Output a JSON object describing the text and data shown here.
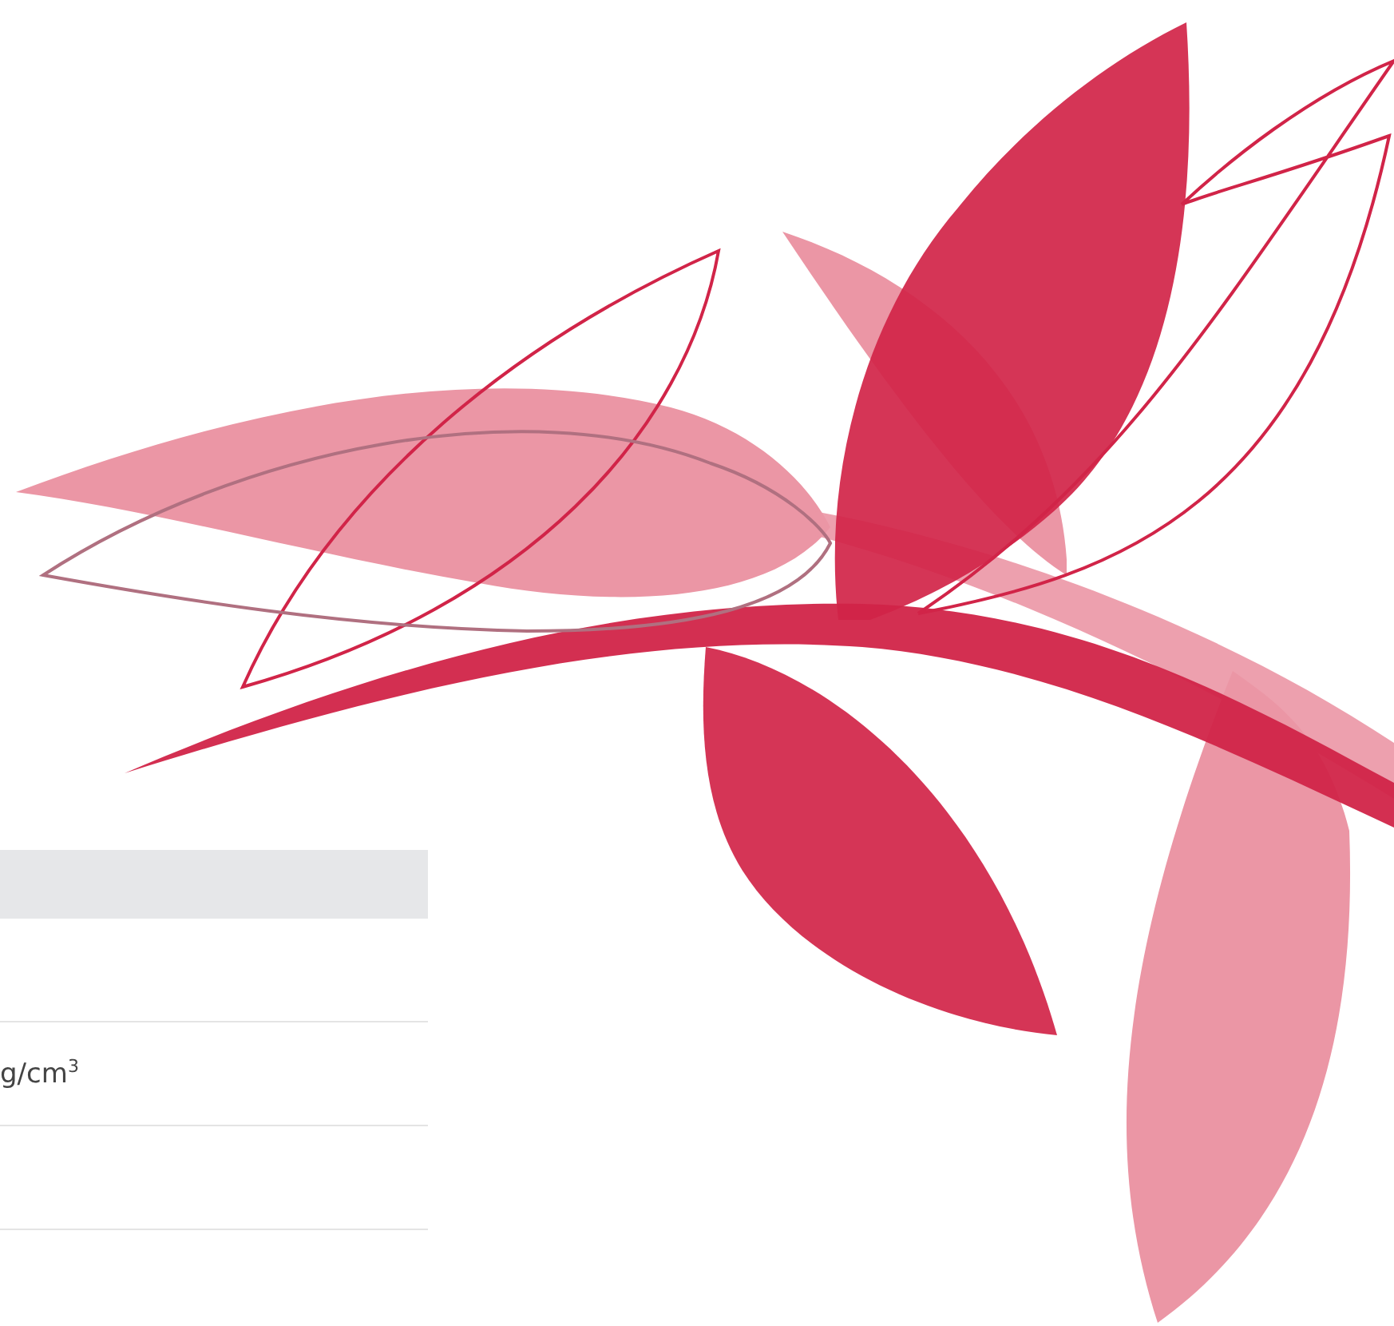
{
  "table": {
    "rows": [
      {
        "cell": "g/cm$^{3}$"
      }
    ]
  }
}
